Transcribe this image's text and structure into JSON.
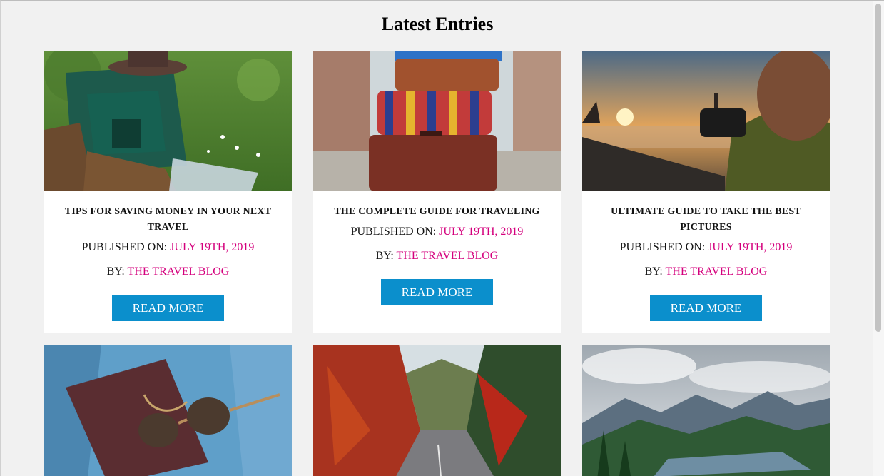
{
  "page": {
    "title": "Latest Entries"
  },
  "labels": {
    "published_prefix": "PUBLISHED ON:",
    "by_prefix": "BY:",
    "read_more": "READ MORE"
  },
  "colors": {
    "accent": "#d4007d",
    "button": "#0b8fcc",
    "background": "#f1f1f1"
  },
  "entries": [
    {
      "title": "TIPS FOR SAVING MONEY IN YOUR NEXT TRAVEL",
      "date": "JULY 19TH, 2019",
      "author": "THE TRAVEL BLOG",
      "image": "backpack-and-boots-photo"
    },
    {
      "title": "THE COMPLETE GUIDE FOR TRAVELING",
      "date": "JULY 19TH, 2019",
      "author": "THE TRAVEL BLOG",
      "image": "stacked-suitcases-photo"
    },
    {
      "title": "ULTIMATE GUIDE TO TAKE THE BEST PICTURES",
      "date": "JULY 19TH, 2019",
      "author": "THE TRAVEL BLOG",
      "image": "photographer-sunset-photo"
    },
    {
      "image": "passport-sunglasses-photo"
    },
    {
      "image": "autumn-road-photo"
    },
    {
      "image": "mountain-lake-photo"
    }
  ]
}
